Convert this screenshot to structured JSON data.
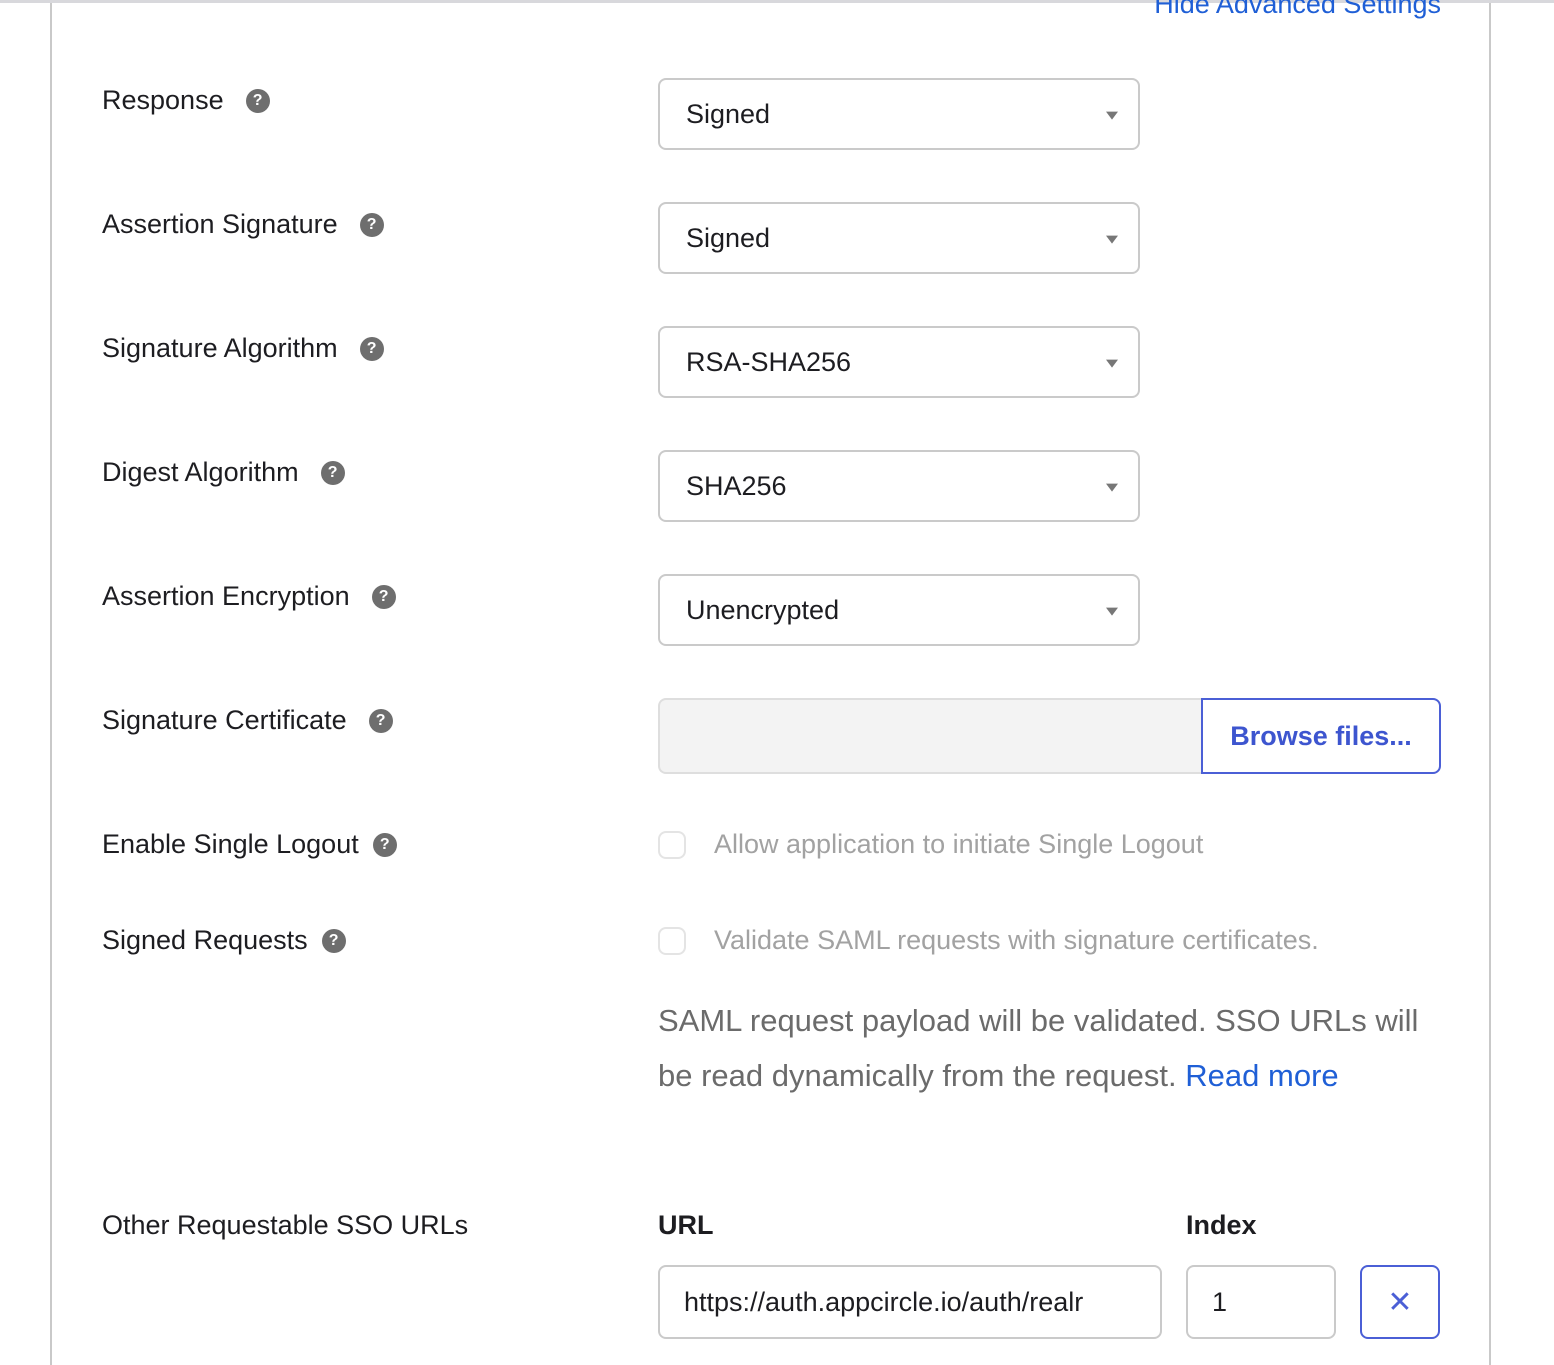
{
  "header": {
    "hide_advanced_label": "Hide Advanced Settings"
  },
  "fields": [
    {
      "label": "Response",
      "value": "Signed"
    },
    {
      "label": "Assertion Signature",
      "value": "Signed"
    },
    {
      "label": "Signature Algorithm",
      "value": "RSA-SHA256"
    },
    {
      "label": "Digest Algorithm",
      "value": "SHA256"
    },
    {
      "label": "Assertion Encryption",
      "value": "Unencrypted"
    }
  ],
  "signature_certificate": {
    "label": "Signature Certificate",
    "file_value": "",
    "browse_label": "Browse files..."
  },
  "single_logout": {
    "label": "Enable Single Logout",
    "checkbox_label": "Allow application to initiate Single Logout",
    "checked": false
  },
  "signed_requests": {
    "label": "Signed Requests",
    "checkbox_label": "Validate SAML requests with signature certificates.",
    "checked": false,
    "help_text": "SAML request payload will be validated. SSO URLs will be read dynamically from the request.",
    "read_more_label": "Read more"
  },
  "other_sso_urls": {
    "label": "Other Requestable SSO URLs",
    "url_header": "URL",
    "index_header": "Index",
    "rows": [
      {
        "url": "https://auth.appcircle.io/auth/realr",
        "index": "1",
        "remove_symbol": "✕"
      }
    ]
  },
  "icons": {
    "help": "?"
  }
}
